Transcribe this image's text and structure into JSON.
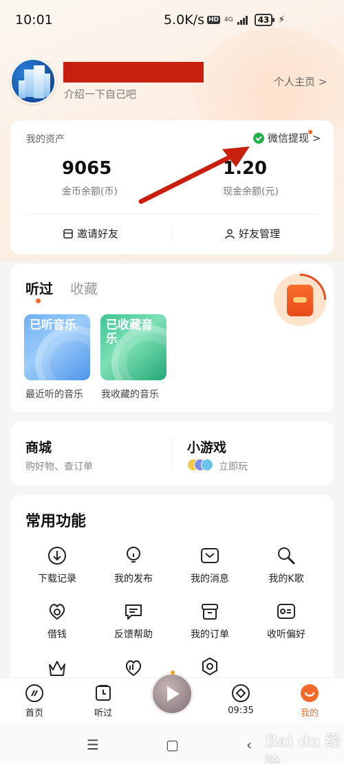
{
  "status_bar": {
    "time": "10:01",
    "net_speed": "5.0K/s",
    "hd": "HD",
    "network": "4G",
    "battery": "43"
  },
  "profile": {
    "description": "介绍一下自己吧",
    "homepage_link": "个人主页 >"
  },
  "assets": {
    "label": "我的资产",
    "withdraw_label": "微信提现 >",
    "coin_value": "9065",
    "coin_label": "金币余额(币)",
    "cash_value": "1.20",
    "cash_label": "现金余额(元)",
    "invite_label": "邀请好友",
    "friends_label": "好友管理"
  },
  "listening": {
    "tabs": [
      "听过",
      "收藏"
    ],
    "tiles": [
      {
        "title": "已听音乐",
        "caption": "最近听的音乐"
      },
      {
        "title": "已收藏音乐",
        "caption": "我收藏的音乐"
      }
    ]
  },
  "shop": {
    "title": "商城",
    "subtitle": "购好物、查订单"
  },
  "game": {
    "title": "小游戏",
    "subtitle": "立即玩"
  },
  "functions": {
    "title": "常用功能",
    "items": [
      {
        "label": "下载记录",
        "icon": "download-icon"
      },
      {
        "label": "我的发布",
        "icon": "publish-icon"
      },
      {
        "label": "我的消息",
        "icon": "message-icon"
      },
      {
        "label": "我的K歌",
        "icon": "karaoke-icon"
      },
      {
        "label": "借钱",
        "icon": "loan-icon"
      },
      {
        "label": "反馈帮助",
        "icon": "feedback-icon"
      },
      {
        "label": "我的订单",
        "icon": "order-icon"
      },
      {
        "label": "收听偏好",
        "icon": "preference-icon"
      }
    ]
  },
  "bottom_nav": {
    "items": [
      {
        "label": "首页",
        "icon": "home-icon"
      },
      {
        "label": "听过",
        "icon": "listened-icon"
      },
      {
        "label": "09:35",
        "icon": "timer-icon"
      },
      {
        "label": "我的",
        "icon": "mine-icon"
      }
    ]
  },
  "watermark": "Bai du 经验",
  "colors": {
    "accent": "#f26a2a",
    "redact": "#c8200e",
    "wechat": "#22b04b",
    "arrow": "#c8200e"
  }
}
